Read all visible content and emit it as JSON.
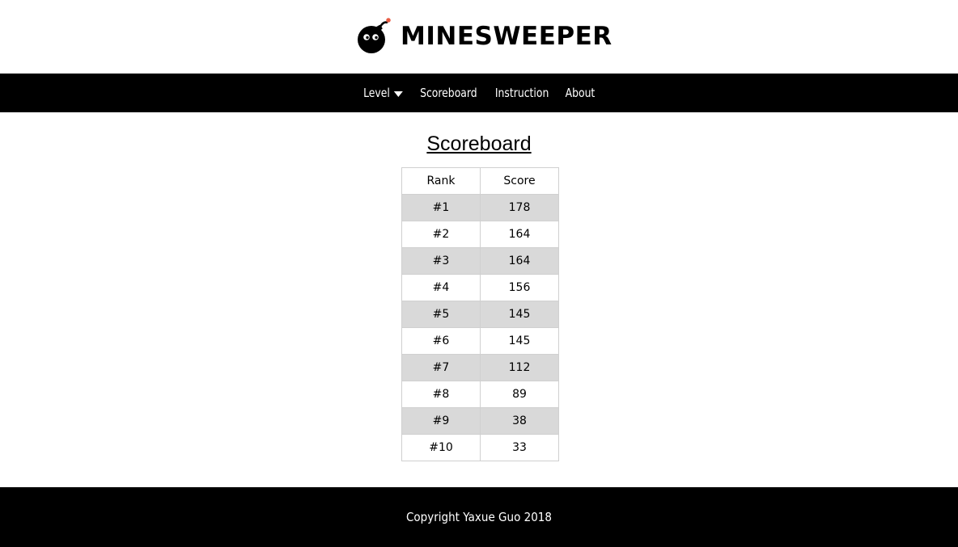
{
  "header": {
    "logo_text": "MINESWEEPER",
    "logo_icon": "bomb-icon"
  },
  "nav": {
    "items": [
      {
        "label": "Level",
        "has_dropdown": true
      },
      {
        "label": "Scoreboard"
      },
      {
        "label": "Instruction"
      },
      {
        "label": "About"
      }
    ]
  },
  "main": {
    "title": "Scoreboard",
    "table": {
      "columns": [
        "Rank",
        "Score"
      ],
      "rows": [
        {
          "rank": "#1",
          "score": "178"
        },
        {
          "rank": "#2",
          "score": "164"
        },
        {
          "rank": "#3",
          "score": "164"
        },
        {
          "rank": "#4",
          "score": "156"
        },
        {
          "rank": "#5",
          "score": "145"
        },
        {
          "rank": "#6",
          "score": "145"
        },
        {
          "rank": "#7",
          "score": "112"
        },
        {
          "rank": "#8",
          "score": "89"
        },
        {
          "rank": "#9",
          "score": "38"
        },
        {
          "rank": "#10",
          "score": "33"
        }
      ]
    }
  },
  "footer": {
    "copyright": "Copyright Yaxue Guo 2018"
  },
  "colors": {
    "nav_bg": "#000000",
    "footer_bg": "#000000",
    "row_stripe": "#d9d9d9",
    "fuse_spark": "#e8553b"
  }
}
